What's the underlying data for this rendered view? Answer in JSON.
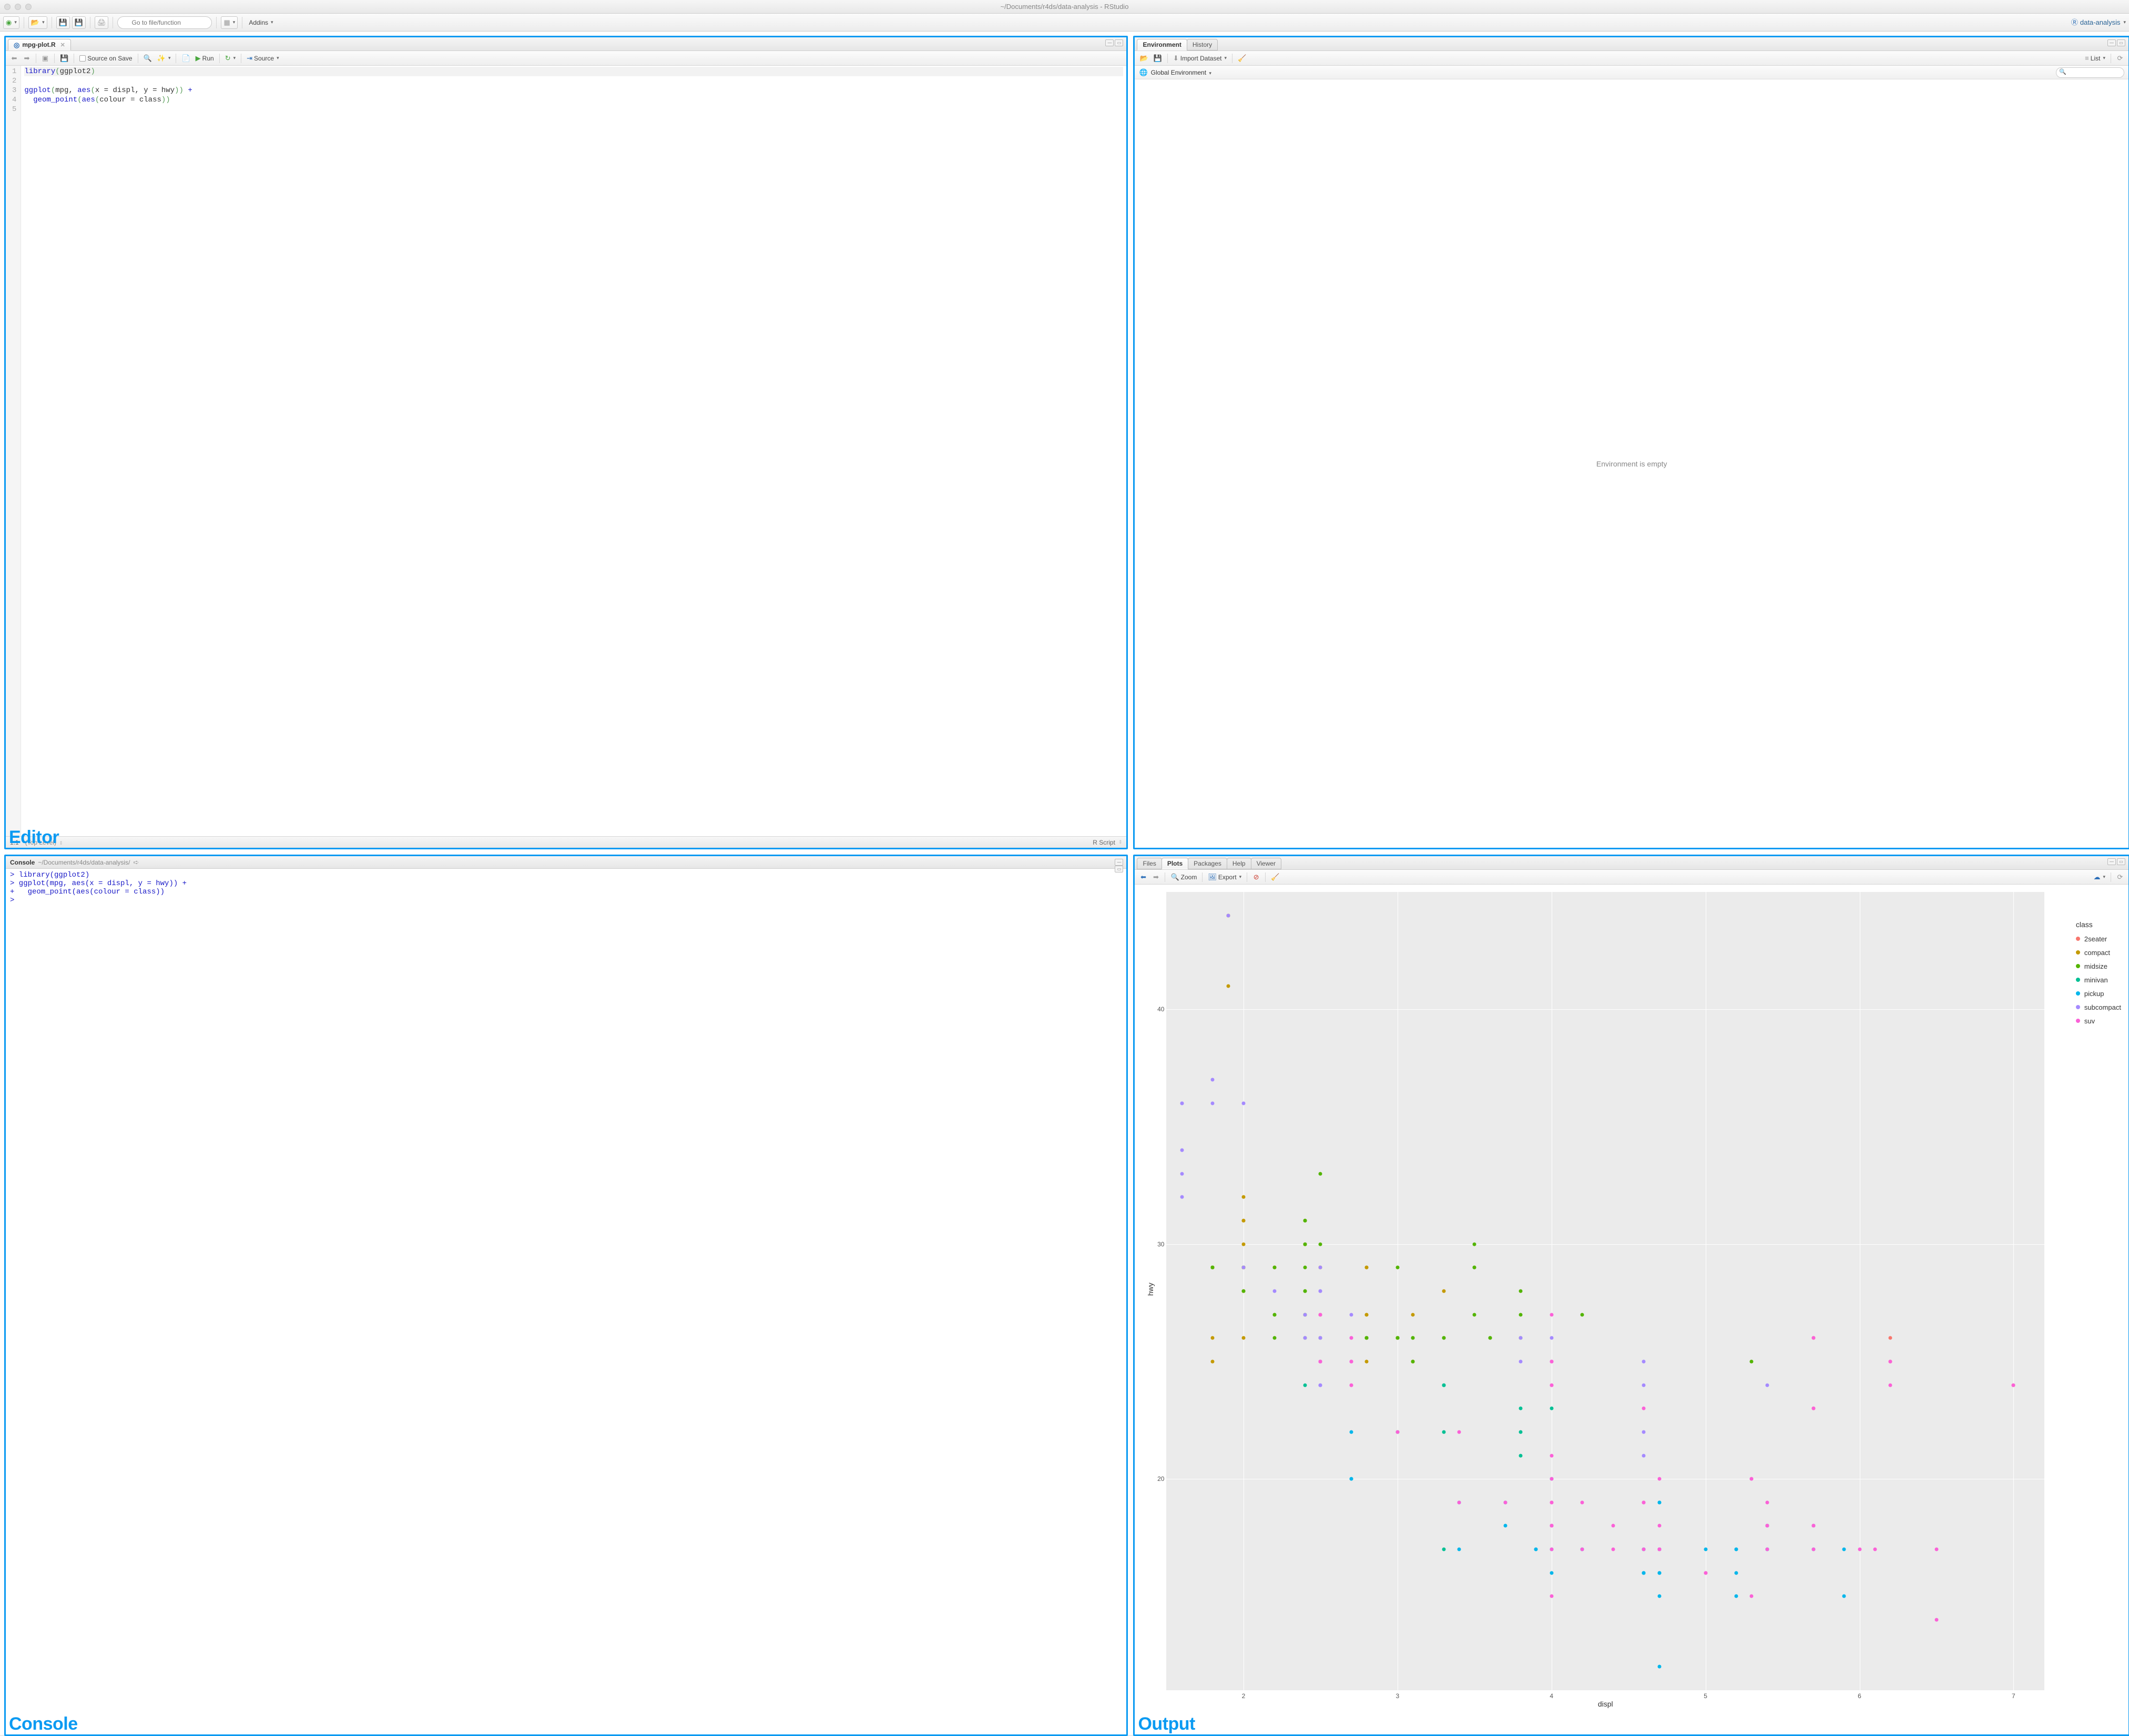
{
  "titlebar": {
    "title": "~/Documents/r4ds/data-analysis - RStudio"
  },
  "main_toolbar": {
    "goto_placeholder": "Go to file/function",
    "addins_label": "Addins",
    "project_label": "data-analysis"
  },
  "editor": {
    "tab_label": "mpg-plot.R",
    "source_on_save": "Source on Save",
    "run_label": "Run",
    "source_label": "Source",
    "status_pos": "1:1",
    "status_scope": "(Top Level)",
    "status_lang": "R Script",
    "line_numbers": [
      "1",
      "2",
      "3",
      "4",
      "5"
    ],
    "code": {
      "l1_a": "library",
      "l1_b": "(",
      "l1_c": "ggplot2",
      "l1_d": ")",
      "l2": "",
      "l3_a": "ggplot",
      "l3_b": "(",
      "l3_c": "mpg, ",
      "l3_d": "aes",
      "l3_e": "(",
      "l3_f": "x = displ, y = hwy",
      "l3_g": "))",
      "l3_h": " +",
      "l4_pad": "  ",
      "l4_a": "geom_point",
      "l4_b": "(",
      "l4_c": "aes",
      "l4_d": "(",
      "l4_e": "colour = class",
      "l4_f": "))",
      "l5": ""
    },
    "pane_label": "Editor"
  },
  "console": {
    "title": "Console",
    "path": "~/Documents/r4ds/data-analysis/",
    "lines": "> library(ggplot2)\n> ggplot(mpg, aes(x = displ, y = hwy)) +\n+   geom_point(aes(colour = class))\n> ",
    "pane_label": "Console"
  },
  "environment": {
    "tabs": [
      "Environment",
      "History"
    ],
    "import_label": "Import Dataset",
    "list_label": "List",
    "scope_label": "Global Environment",
    "empty_text": "Environment is empty",
    "search_placeholder": ""
  },
  "output": {
    "tabs": [
      "Files",
      "Plots",
      "Packages",
      "Help",
      "Viewer"
    ],
    "active_tab_index": 1,
    "zoom_label": "Zoom",
    "export_label": "Export",
    "pane_label": "Output"
  },
  "chart_data": {
    "type": "scatter",
    "title": "",
    "xlabel": "displ",
    "ylabel": "hwy",
    "xlim": [
      1.5,
      7.2
    ],
    "ylim": [
      11,
      45
    ],
    "x_ticks": [
      2,
      3,
      4,
      5,
      6,
      7
    ],
    "y_ticks": [
      20,
      30,
      40
    ],
    "legend_title": "class",
    "series": [
      {
        "name": "2seater",
        "color": "#F8766D",
        "points": [
          [
            5.7,
            26
          ],
          [
            5.7,
            23
          ],
          [
            6.2,
            26
          ],
          [
            6.2,
            25
          ],
          [
            7.0,
            24
          ]
        ]
      },
      {
        "name": "compact",
        "color": "#C49A00",
        "points": [
          [
            1.8,
            29
          ],
          [
            1.8,
            29
          ],
          [
            2.0,
            31
          ],
          [
            2.0,
            30
          ],
          [
            2.8,
            26
          ],
          [
            2.8,
            26
          ],
          [
            3.1,
            27
          ],
          [
            1.8,
            26
          ],
          [
            1.8,
            25
          ],
          [
            2.0,
            28
          ],
          [
            2.0,
            29
          ],
          [
            2.8,
            27
          ],
          [
            2.8,
            25
          ],
          [
            3.1,
            25
          ],
          [
            3.1,
            25
          ],
          [
            2.4,
            30
          ],
          [
            2.4,
            30
          ],
          [
            2.5,
            26
          ],
          [
            2.5,
            27
          ],
          [
            2.2,
            29
          ],
          [
            2.2,
            29
          ],
          [
            2.4,
            31
          ],
          [
            2.4,
            30
          ],
          [
            3.0,
            26
          ],
          [
            3.3,
            28
          ],
          [
            1.8,
            29
          ],
          [
            1.8,
            29
          ],
          [
            1.8,
            29
          ],
          [
            1.8,
            29
          ],
          [
            1.8,
            29
          ],
          [
            2.0,
            28
          ],
          [
            2.0,
            29
          ],
          [
            2.0,
            31
          ],
          [
            2.0,
            32
          ],
          [
            2.8,
            27
          ],
          [
            1.9,
            44
          ],
          [
            2.0,
            26
          ],
          [
            2.0,
            29
          ],
          [
            2.0,
            29
          ],
          [
            2.0,
            29
          ],
          [
            2.0,
            29
          ],
          [
            2.5,
            29
          ],
          [
            2.5,
            29
          ],
          [
            2.8,
            29
          ],
          [
            2.8,
            29
          ],
          [
            1.9,
            41
          ],
          [
            1.9,
            44
          ]
        ]
      },
      {
        "name": "midsize",
        "color": "#53B400",
        "points": [
          [
            2.8,
            26
          ],
          [
            3.1,
            25
          ],
          [
            4.2,
            27
          ],
          [
            2.4,
            29
          ],
          [
            2.4,
            27
          ],
          [
            3.1,
            26
          ],
          [
            3.5,
            29
          ],
          [
            3.6,
            26
          ],
          [
            2.4,
            26
          ],
          [
            2.4,
            27
          ],
          [
            2.4,
            30
          ],
          [
            2.4,
            30
          ],
          [
            2.5,
            26
          ],
          [
            2.5,
            25
          ],
          [
            3.3,
            26
          ],
          [
            2.5,
            30
          ],
          [
            2.5,
            33
          ],
          [
            3.5,
            30
          ],
          [
            3.0,
            26
          ],
          [
            3.0,
            26
          ],
          [
            3.5,
            27
          ],
          [
            3.1,
            26
          ],
          [
            3.8,
            26
          ],
          [
            3.8,
            27
          ],
          [
            3.8,
            28
          ],
          [
            5.3,
            25
          ],
          [
            2.2,
            27
          ],
          [
            2.2,
            29
          ],
          [
            2.4,
            31
          ],
          [
            2.4,
            31
          ],
          [
            3.0,
            26
          ],
          [
            3.0,
            26
          ],
          [
            3.5,
            29
          ],
          [
            2.2,
            26
          ],
          [
            2.2,
            27
          ],
          [
            2.4,
            28
          ],
          [
            2.4,
            28
          ],
          [
            3.0,
            26
          ],
          [
            3.0,
            29
          ],
          [
            3.3,
            26
          ],
          [
            1.8,
            29
          ],
          [
            1.8,
            29
          ],
          [
            2.0,
            28
          ],
          [
            2.0,
            29
          ],
          [
            2.8,
            26
          ],
          [
            2.8,
            26
          ],
          [
            3.6,
            26
          ]
        ]
      },
      {
        "name": "minivan",
        "color": "#00C094",
        "points": [
          [
            2.4,
            24
          ],
          [
            3.0,
            22
          ],
          [
            3.3,
            24
          ],
          [
            3.3,
            22
          ],
          [
            3.3,
            24
          ],
          [
            3.3,
            24
          ],
          [
            3.3,
            17
          ],
          [
            3.8,
            22
          ],
          [
            3.8,
            21
          ],
          [
            3.8,
            23
          ],
          [
            4.0,
            23
          ]
        ]
      },
      {
        "name": "pickup",
        "color": "#00B6EB",
        "points": [
          [
            3.7,
            19
          ],
          [
            3.7,
            18
          ],
          [
            3.9,
            17
          ],
          [
            3.9,
            17
          ],
          [
            4.7,
            19
          ],
          [
            4.7,
            19
          ],
          [
            4.7,
            12
          ],
          [
            5.2,
            17
          ],
          [
            5.2,
            15
          ],
          [
            5.7,
            18
          ],
          [
            5.9,
            17
          ],
          [
            4.7,
            17
          ],
          [
            4.7,
            17
          ],
          [
            4.7,
            16
          ],
          [
            4.7,
            16
          ],
          [
            4.7,
            17
          ],
          [
            4.7,
            17
          ],
          [
            5.2,
            17
          ],
          [
            5.2,
            16
          ],
          [
            5.7,
            17
          ],
          [
            5.9,
            15
          ],
          [
            4.6,
            16
          ],
          [
            5.4,
            18
          ],
          [
            5.4,
            17
          ],
          [
            4.2,
            17
          ],
          [
            4.2,
            17
          ],
          [
            4.6,
            16
          ],
          [
            4.6,
            16
          ],
          [
            4.6,
            17
          ],
          [
            5.4,
            17
          ],
          [
            5.4,
            18
          ],
          [
            2.7,
            20
          ],
          [
            2.7,
            20
          ],
          [
            2.7,
            22
          ],
          [
            3.4,
            17
          ],
          [
            3.4,
            19
          ],
          [
            4.0,
            20
          ],
          [
            4.0,
            17
          ],
          [
            4.7,
            17
          ],
          [
            4.7,
            15
          ],
          [
            4.7,
            16
          ],
          [
            4.0,
            16
          ],
          [
            4.0,
            18
          ],
          [
            4.6,
            17
          ],
          [
            5.0,
            17
          ]
        ]
      },
      {
        "name": "subcompact",
        "color": "#A58AFF",
        "points": [
          [
            3.8,
            26
          ],
          [
            3.8,
            25
          ],
          [
            4.0,
            26
          ],
          [
            4.0,
            25
          ],
          [
            4.6,
            25
          ],
          [
            4.6,
            24
          ],
          [
            4.6,
            21
          ],
          [
            4.6,
            22
          ],
          [
            5.4,
            24
          ],
          [
            1.6,
            33
          ],
          [
            1.6,
            32
          ],
          [
            1.6,
            34
          ],
          [
            1.6,
            36
          ],
          [
            1.6,
            36
          ],
          [
            1.8,
            36
          ],
          [
            1.8,
            37
          ],
          [
            2.0,
            36
          ],
          [
            2.4,
            26
          ],
          [
            2.4,
            27
          ],
          [
            2.5,
            24
          ],
          [
            2.5,
            24
          ],
          [
            2.5,
            24
          ],
          [
            2.5,
            25
          ],
          [
            2.5,
            26
          ],
          [
            2.5,
            26
          ],
          [
            2.2,
            28
          ],
          [
            2.5,
            25
          ],
          [
            2.5,
            29
          ],
          [
            2.7,
            27
          ],
          [
            2.7,
            25
          ],
          [
            2.7,
            26
          ],
          [
            1.9,
            44
          ],
          [
            2.0,
            29
          ],
          [
            2.5,
            28
          ],
          [
            2.5,
            28
          ]
        ]
      },
      {
        "name": "suv",
        "color": "#FB61D7",
        "points": [
          [
            5.3,
            20
          ],
          [
            5.3,
            15
          ],
          [
            5.3,
            20
          ],
          [
            5.7,
            17
          ],
          [
            6.0,
            17
          ],
          [
            5.7,
            26
          ],
          [
            5.7,
            23
          ],
          [
            6.2,
            25
          ],
          [
            6.2,
            24
          ],
          [
            7.0,
            24
          ],
          [
            6.5,
            17
          ],
          [
            2.7,
            24
          ],
          [
            2.7,
            25
          ],
          [
            3.4,
            22
          ],
          [
            3.4,
            19
          ],
          [
            4.0,
            15
          ],
          [
            4.7,
            18
          ],
          [
            4.7,
            17
          ],
          [
            4.7,
            17
          ],
          [
            5.7,
            18
          ],
          [
            6.1,
            17
          ],
          [
            4.0,
            17
          ],
          [
            4.0,
            19
          ],
          [
            4.0,
            18
          ],
          [
            4.0,
            21
          ],
          [
            4.0,
            24
          ],
          [
            4.2,
            17
          ],
          [
            4.4,
            18
          ],
          [
            4.6,
            19
          ],
          [
            5.4,
            19
          ],
          [
            5.4,
            18
          ],
          [
            4.0,
            25
          ],
          [
            4.0,
            24
          ],
          [
            4.0,
            27
          ],
          [
            4.0,
            25
          ],
          [
            4.6,
            23
          ],
          [
            5.0,
            16
          ],
          [
            2.5,
            27
          ],
          [
            2.5,
            25
          ],
          [
            2.5,
            27
          ],
          [
            2.5,
            25
          ],
          [
            2.7,
            25
          ],
          [
            2.7,
            24
          ],
          [
            2.7,
            26
          ],
          [
            3.0,
            22
          ],
          [
            3.7,
            19
          ],
          [
            4.0,
            20
          ],
          [
            4.7,
            17
          ],
          [
            4.7,
            20
          ],
          [
            4.7,
            17
          ],
          [
            5.7,
            18
          ],
          [
            6.5,
            14
          ],
          [
            4.0,
            19
          ],
          [
            4.2,
            19
          ],
          [
            4.4,
            17
          ],
          [
            4.6,
            17
          ],
          [
            5.4,
            17
          ],
          [
            5.4,
            18
          ],
          [
            4.0,
            18
          ],
          [
            4.0,
            18
          ],
          [
            4.6,
            19
          ],
          [
            5.0,
            16
          ]
        ]
      }
    ]
  }
}
